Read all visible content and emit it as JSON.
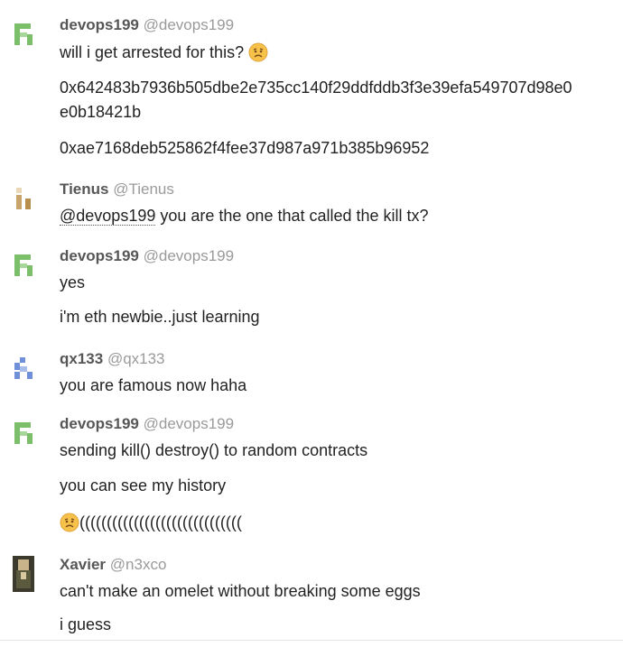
{
  "messages": [
    {
      "name": "devops199",
      "handle": "@devops199",
      "lines": [
        "will i get arrested for this? ",
        "0x642483b7936b505dbe2e735cc140f29ddfddb3f3e39efa549707d98e0",
        "e0b18421b",
        "0xae7168deb525862f4fee37d987a971b385b96952"
      ]
    },
    {
      "name": "Tienus",
      "handle": "@Tienus",
      "mention": "@devops199",
      "lines": [
        " you are the one that called the kill tx?"
      ]
    },
    {
      "name": "devops199",
      "handle": "@devops199",
      "lines": [
        "yes",
        "i'm eth newbie..just learning"
      ]
    },
    {
      "name": "qx133",
      "handle": "@qx133",
      "lines": [
        "you are famous now haha"
      ]
    },
    {
      "name": "devops199",
      "handle": "@devops199",
      "lines": [
        "sending kill() destroy() to random contracts",
        "you can see my history",
        "(((((((((((((((((((((((((((((("
      ]
    },
    {
      "name": "Xavier",
      "handle": "@n3xco",
      "lines": [
        "can't make an omelet without breaking some eggs",
        "i guess"
      ]
    }
  ],
  "icons": {
    "worried_emoji": "worried-face-emoji"
  },
  "colors": {
    "name": "#565656",
    "handle": "#9a9a9a",
    "text": "#222222",
    "avatar_green": "#7bbf6a",
    "avatar_blue": "#6f8fd8",
    "avatar_tan": "#c9a46a"
  }
}
